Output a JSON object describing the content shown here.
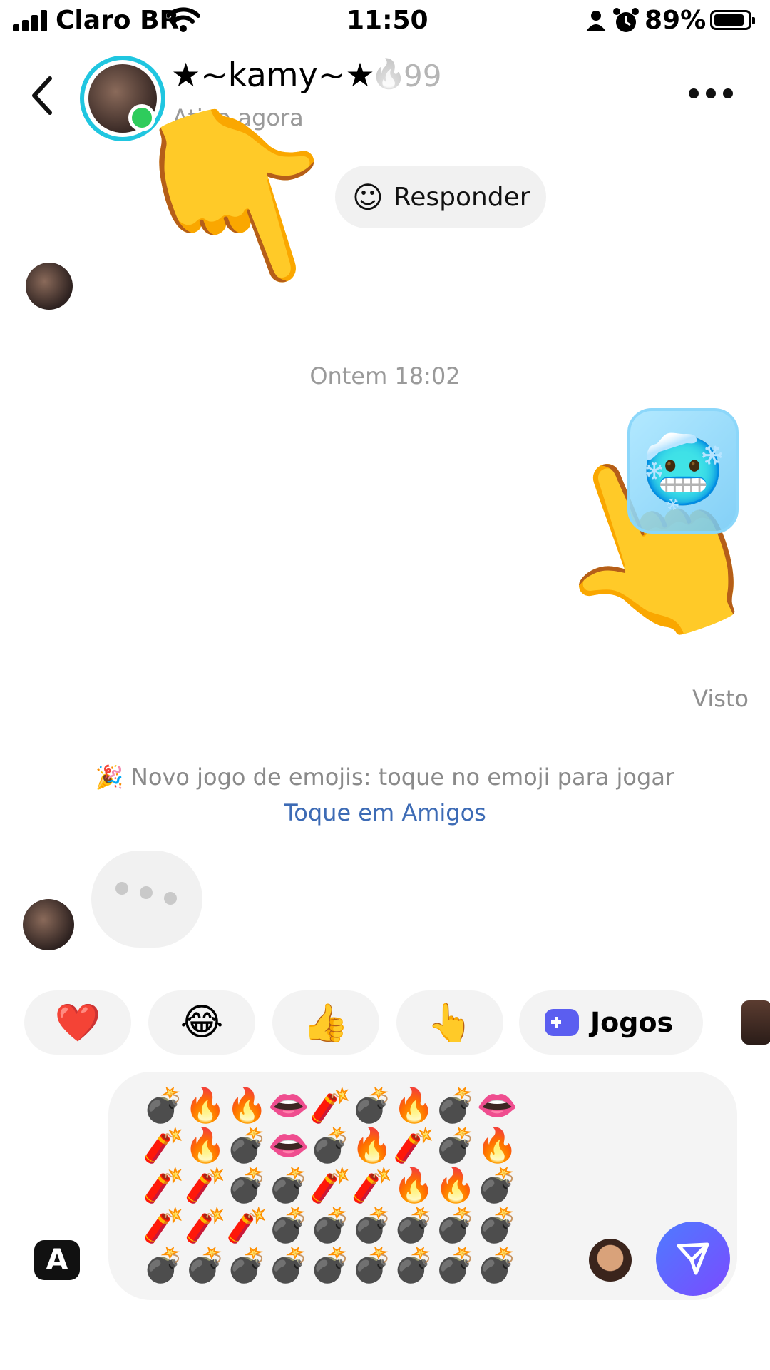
{
  "status_bar": {
    "carrier": "Claro BR",
    "time": "11:50",
    "battery_percent": "89%",
    "battery_level": 0.89,
    "icons": [
      "signal-icon",
      "wifi-icon",
      "person-icon",
      "alarm-icon",
      "battery-icon"
    ]
  },
  "header": {
    "contact_name": "★~kamy~★",
    "streak_count": "99",
    "presence": "Ativo agora",
    "icons": [
      "back-icon",
      "flame-icon",
      "more-icon"
    ]
  },
  "conversation": {
    "reply_label": "Responder",
    "timestamp": "Ontem 18:02",
    "seen_label": "Visto",
    "notice_text": "🎉 Novo jogo de emojis: toque no emoji para jogar",
    "notice_link": "Toque em Amigos"
  },
  "quick_reactions": {
    "items": [
      "❤️",
      "😂",
      "👍",
      "👆"
    ],
    "games_label": "Jogos"
  },
  "composer": {
    "emoji_rows": [
      "💣🔥🔥👄🧨💣🔥💣👄",
      "🧨🔥💣👄💣🔥🧨💣🔥",
      "🧨🧨💣💣🧨🧨🔥🔥💣",
      "🧨🧨🧨💣💣💣💣💣💣",
      "💣💣💣💣💣💣💣💣💣",
      "💣🔥🔥🔥🔥🔥🔥🔥🔥"
    ],
    "ai_label": "A",
    "icons": [
      "bitmoji-icon",
      "send-icon"
    ]
  }
}
